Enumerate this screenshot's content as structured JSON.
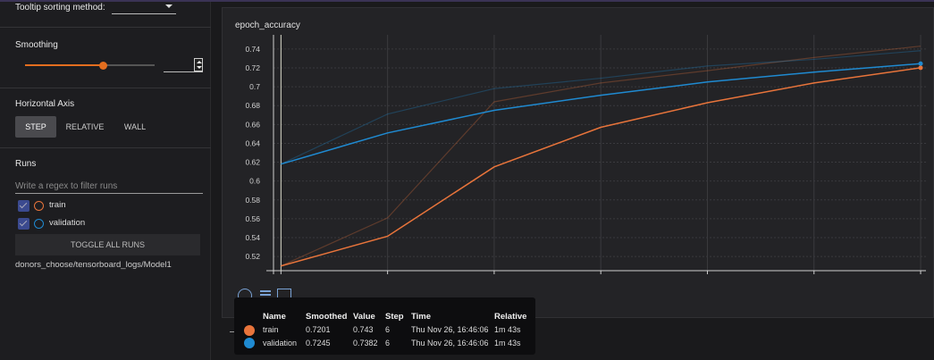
{
  "tooltip_sorting": {
    "label": "Tooltip sorting method:",
    "value": ""
  },
  "smoothing": {
    "title": "Smoothing",
    "value": 0.6
  },
  "horizontal_axis": {
    "title": "Horizontal Axis",
    "options": [
      "STEP",
      "RELATIVE",
      "WALL"
    ],
    "selected": "STEP"
  },
  "runs": {
    "title": "Runs",
    "filter_placeholder": "Write a regex to filter runs",
    "items": [
      {
        "label": "train",
        "color": "#e8743b"
      },
      {
        "label": "validation",
        "color": "#1f8ad1"
      }
    ],
    "toggle_label": "TOGGLE ALL RUNS",
    "path": "donors_choose/tensorboard_logs/Model1"
  },
  "card": {
    "title": "epoch_accuracy"
  },
  "chart_data": {
    "type": "line",
    "title": "epoch_accuracy",
    "xlabel": "",
    "ylabel": "",
    "x": [
      0,
      1,
      2,
      3,
      4,
      5,
      6
    ],
    "xlim": [
      -0.07,
      6.05
    ],
    "ylim": [
      0.505,
      0.755
    ],
    "y_ticks": [
      "0.52",
      "0.54",
      "0.56",
      "0.58",
      "0.6",
      "0.62",
      "0.64",
      "0.66",
      "0.68",
      "0.7",
      "0.72",
      "0.74"
    ],
    "grid": true,
    "series": [
      {
        "name": "train",
        "color": "#e8743b",
        "smoothed": [
          0.51,
          0.5415,
          0.615,
          0.657,
          0.683,
          0.704,
          0.7201
        ],
        "raw": [
          0.51,
          0.561,
          0.684,
          0.704,
          0.717,
          0.731,
          0.743
        ]
      },
      {
        "name": "validation",
        "color": "#1f8ad1",
        "smoothed": [
          0.618,
          0.651,
          0.675,
          0.691,
          0.705,
          0.7155,
          0.7245
        ],
        "raw": [
          0.618,
          0.671,
          0.698,
          0.709,
          0.722,
          0.729,
          0.7382
        ]
      }
    ]
  },
  "tooltip": {
    "headers": {
      "name": "Name",
      "smoothed": "Smoothed",
      "value": "Value",
      "step": "Step",
      "time": "Time",
      "relative": "Relative"
    },
    "rows": [
      {
        "color": "#e8743b",
        "name": "train",
        "smoothed": "0.7201",
        "value": "0.743",
        "step": "6",
        "time": "Thu Nov 26, 16:46:06",
        "relative": "1m 43s"
      },
      {
        "color": "#1f8ad1",
        "name": "validation",
        "smoothed": "0.7245",
        "value": "0.7382",
        "step": "6",
        "time": "Thu Nov 26, 16:46:06",
        "relative": "1m 43s"
      }
    ]
  }
}
